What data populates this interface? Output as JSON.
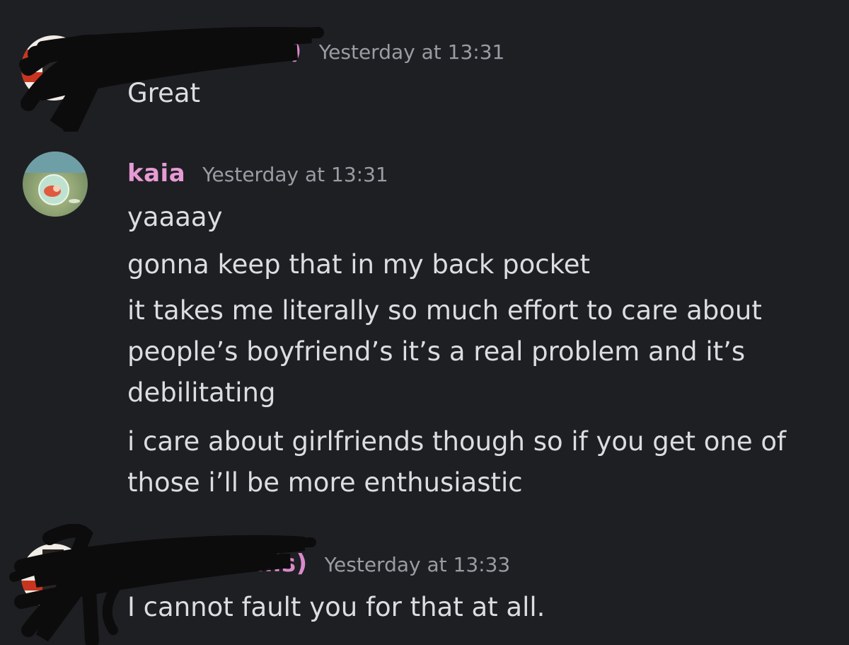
{
  "messages": [
    {
      "author_visible_fragment": "s)",
      "timestamp": "Yesterday at 13:31",
      "lines": [
        "Great"
      ]
    },
    {
      "author": "kaia",
      "author_color": "#e69bd3",
      "timestamp": "Yesterday at 13:31",
      "lines": [
        "yaaaay",
        "gonna keep that in my back pocket",
        "it takes me literally so much effort to care about",
        "people’s boyfriend’s it’s a real problem and it’s",
        "debilitating",
        "i care about girlfriends though so if you get one of",
        "those i’ll be more enthusiastic"
      ]
    },
    {
      "author_visible_fragment": "Bills)",
      "timestamp": "Yesterday at 13:33",
      "lines": [
        "I cannot fault you for that at all."
      ]
    }
  ],
  "colors": {
    "background": "#1e1f23",
    "text": "#dcdde0",
    "timestamp": "#9a9ca3",
    "redacted_username": "#d98ac9"
  },
  "icons": {
    "avatar_1": "redacted-avatar-icon",
    "avatar_2": "ponyo-bubble-avatar",
    "avatar_3": "redacted-avatar-icon"
  }
}
